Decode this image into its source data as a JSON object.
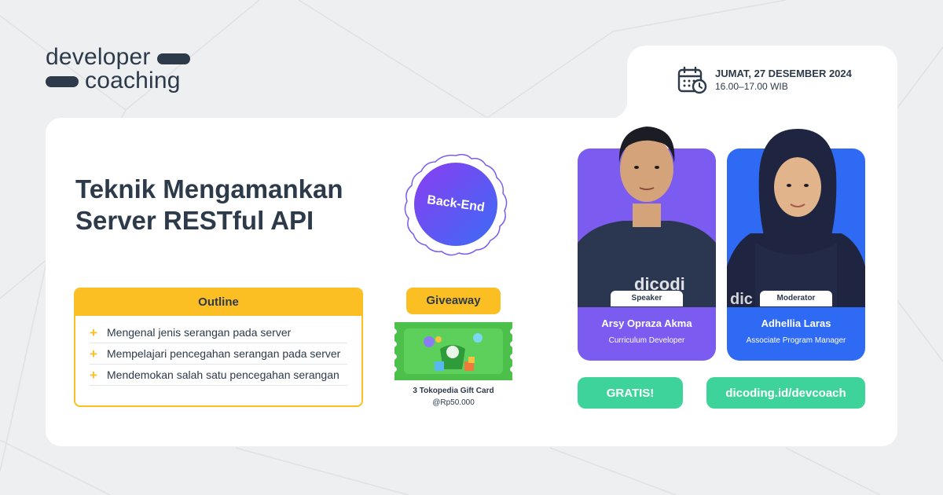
{
  "brand": {
    "word1": "developer",
    "word2": "coaching",
    "color": "#2d3a4a"
  },
  "event": {
    "date": "JUMAT, 27 DESEMBER 2024",
    "time": "16.00–17.00 WIB"
  },
  "title": {
    "line1": "Teknik Mengamankan",
    "line2": "Server RESTful API"
  },
  "badge": {
    "label": "Back-End"
  },
  "outline": {
    "heading": "Outline",
    "items": [
      "Mengenal jenis serangan pada server",
      "Mempelajari pencegahan serangan pada server",
      "Mendemokan salah satu pencegahan serangan"
    ]
  },
  "giveaway": {
    "heading": "Giveaway",
    "prize": "3 Tokopedia Gift Card",
    "value": "@Rp50.000"
  },
  "speaker": {
    "tag": "Speaker",
    "name": "Arsy Opraza Akma",
    "role": "Curriculum Developer"
  },
  "moderator": {
    "tag": "Moderator",
    "name": "Adhellia Laras",
    "role": "Associate Program Manager"
  },
  "cta": {
    "free_label": "GRATIS!",
    "link_label": "dicoding.id/devcoach"
  },
  "colors": {
    "accent_yellow": "#fbbf24",
    "accent_green": "#3dd39a",
    "speaker_purple": "#7c5cf0",
    "moderator_blue": "#2f6af5"
  },
  "icons": {
    "calendar": "calendar-clock-icon",
    "bullet": "plus-icon"
  }
}
